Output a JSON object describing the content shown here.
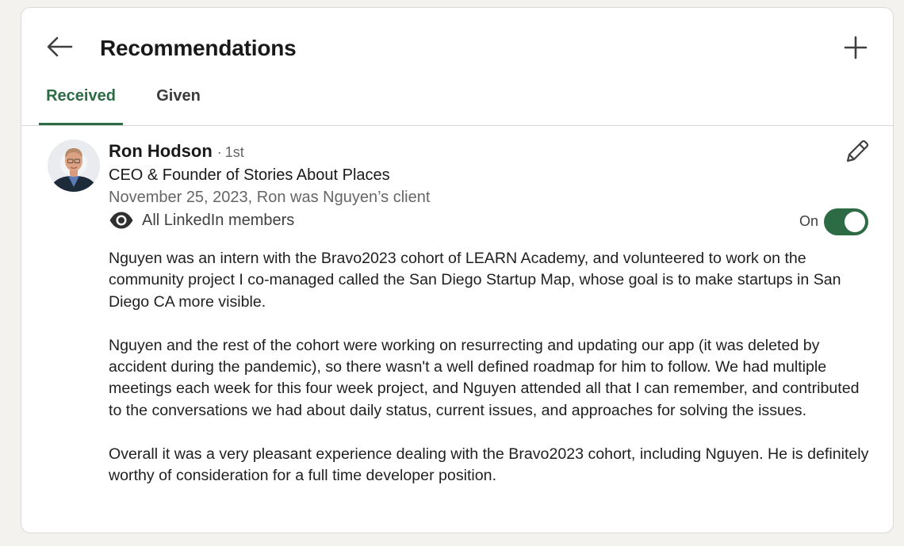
{
  "header": {
    "title": "Recommendations",
    "back_icon": "arrow-left-icon",
    "add_icon": "plus-icon"
  },
  "tabs": [
    {
      "label": "Received",
      "active": true
    },
    {
      "label": "Given",
      "active": false
    }
  ],
  "colors": {
    "accent": "#2d6b45",
    "background": "#f4f2ee",
    "card": "#ffffff",
    "secondary_text": "#666666"
  },
  "recommendation": {
    "name": "Ron Hodson",
    "separator": "·",
    "degree": "1st",
    "headline": "CEO & Founder of Stories About Places",
    "relation": "November 25, 2023, Ron was Nguyen’s client",
    "visibility_icon": "eye-icon",
    "visibility": "All LinkedIn members",
    "edit_icon": "pencil-icon",
    "toggle_label": "On",
    "toggle_on": true,
    "paragraphs": [
      "Nguyen was an intern with the Bravo2023 cohort of LEARN Academy, and volunteered to work on the community project I co-managed called the San Diego Startup Map, whose goal is to make startups in San Diego CA more visible.",
      "Nguyen and the rest of the cohort were working on resurrecting and updating our app (it was deleted by accident during the pandemic), so there wasn't a well defined roadmap for him to follow. We had multiple meetings each week for this four week project, and Nguyen attended all that I can remember, and contributed to the conversations we had about daily status, current issues, and approaches for solving the issues.",
      "Overall it was a very pleasant experience dealing with the Bravo2023 cohort, including Nguyen. He is definitely worthy of consideration for a full time developer position."
    ]
  }
}
